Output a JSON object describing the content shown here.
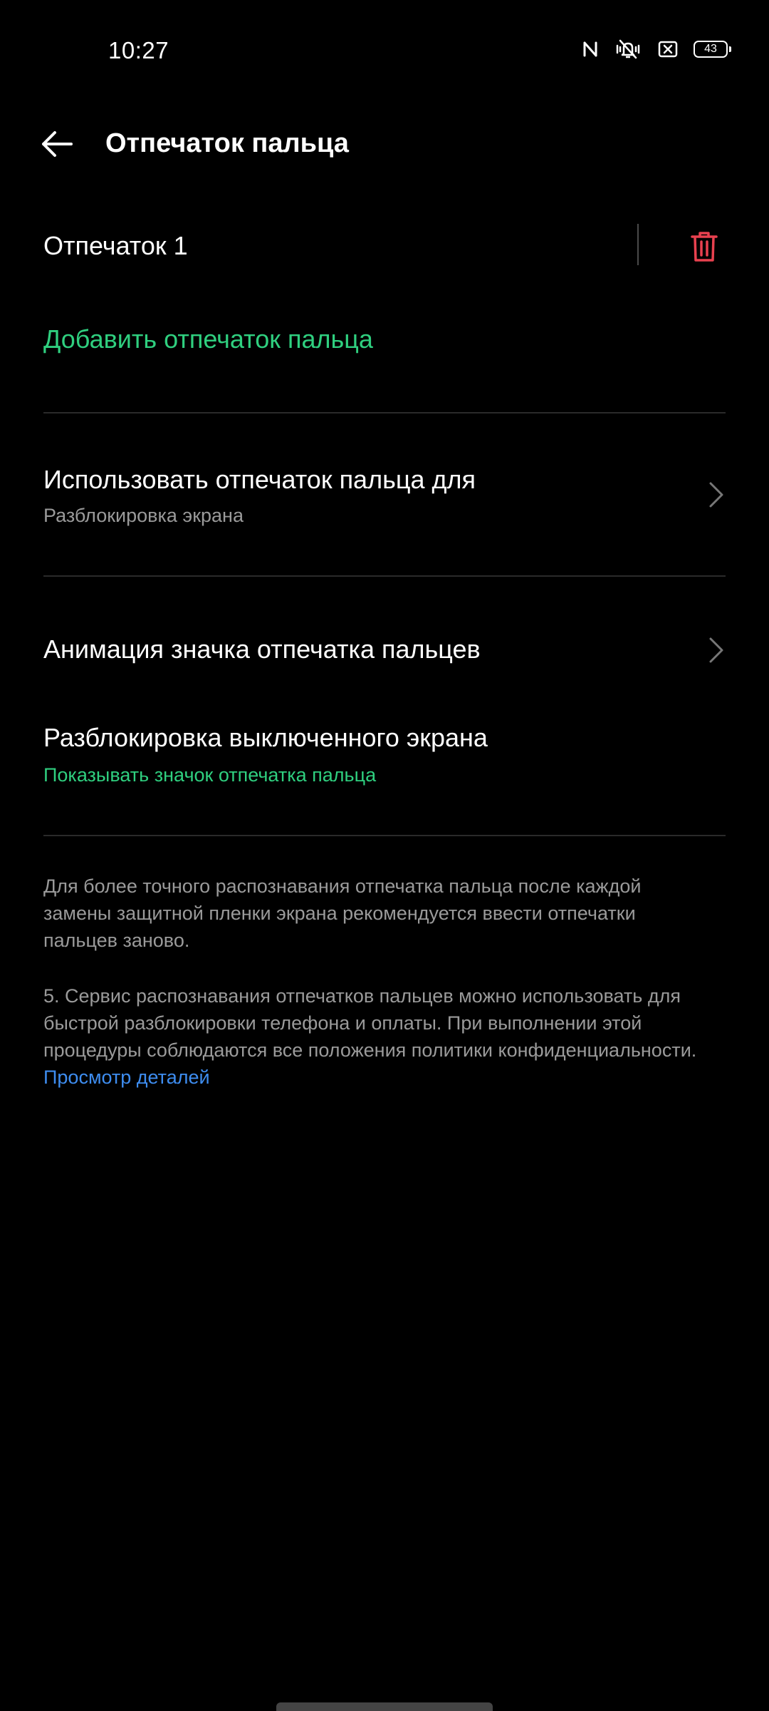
{
  "status_bar": {
    "time": "10:27",
    "battery_level": "43",
    "icons": [
      "nfc-icon",
      "vibrate-silent-icon",
      "screen-block-icon",
      "battery-icon"
    ]
  },
  "header": {
    "title": "Отпечаток пальца",
    "back_icon": "arrow-back-icon"
  },
  "fingerprints": [
    {
      "name": "Отпечаток 1",
      "delete_icon": "trash-icon"
    }
  ],
  "add_fingerprint_label": "Добавить отпечаток пальца",
  "settings": {
    "use_for": {
      "title": "Использовать отпечаток пальца для",
      "subtitle": "Разблокировка экрана"
    },
    "icon_animation": {
      "title": "Анимация значка отпечатка пальцев"
    },
    "screen_off_unlock": {
      "title": "Разблокировка выключенного экрана",
      "subtitle": "Показывать значок отпечатка пальца"
    }
  },
  "notes": {
    "film_note": "Для более точного распознавания отпечатка пальца после каждой замены защитной пленки экрана рекомендуется ввести отпечатки пальцев заново.",
    "privacy_note": "5. Сервис распознавания отпечатков пальцев можно использовать для быстрой разблокировки телефона и оплаты. При выполнении этой процедуры соблюдаются все положения политики конфиденциальности.",
    "privacy_link": "Просмотр деталей"
  },
  "colors": {
    "background": "#000000",
    "accent_green": "#2fcf7f",
    "link_blue": "#3e8df0",
    "delete_red": "#e8414f",
    "secondary_text": "#9a9a9a"
  }
}
